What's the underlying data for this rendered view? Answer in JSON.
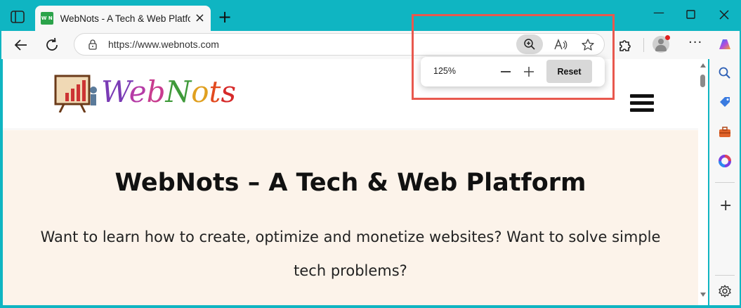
{
  "tab": {
    "title": "WebNots - A Tech & Web Platform",
    "favicon_text": "W N"
  },
  "addressbar": {
    "url": "https://www.webnots.com"
  },
  "zoom_popup": {
    "level": "125%",
    "reset_label": "Reset"
  },
  "site": {
    "logo_letters": [
      "W",
      "e",
      "b",
      "N",
      "o",
      "t",
      "s"
    ],
    "logo_colors": [
      "#7a3bb5",
      "#b53ba6",
      "#c83c8f",
      "#3f9a3a",
      "#e0a020",
      "#e24a1f",
      "#d62a2a"
    ],
    "hero_title": "WebNots – A Tech & Web Platform",
    "hero_text": "Want to learn how to create, optimize and monetize websites? Want to solve simple tech problems?"
  },
  "colors": {
    "frame": "#0fb5c2",
    "highlight": "#e8584e",
    "hero_bg": "#fcf3ea"
  }
}
